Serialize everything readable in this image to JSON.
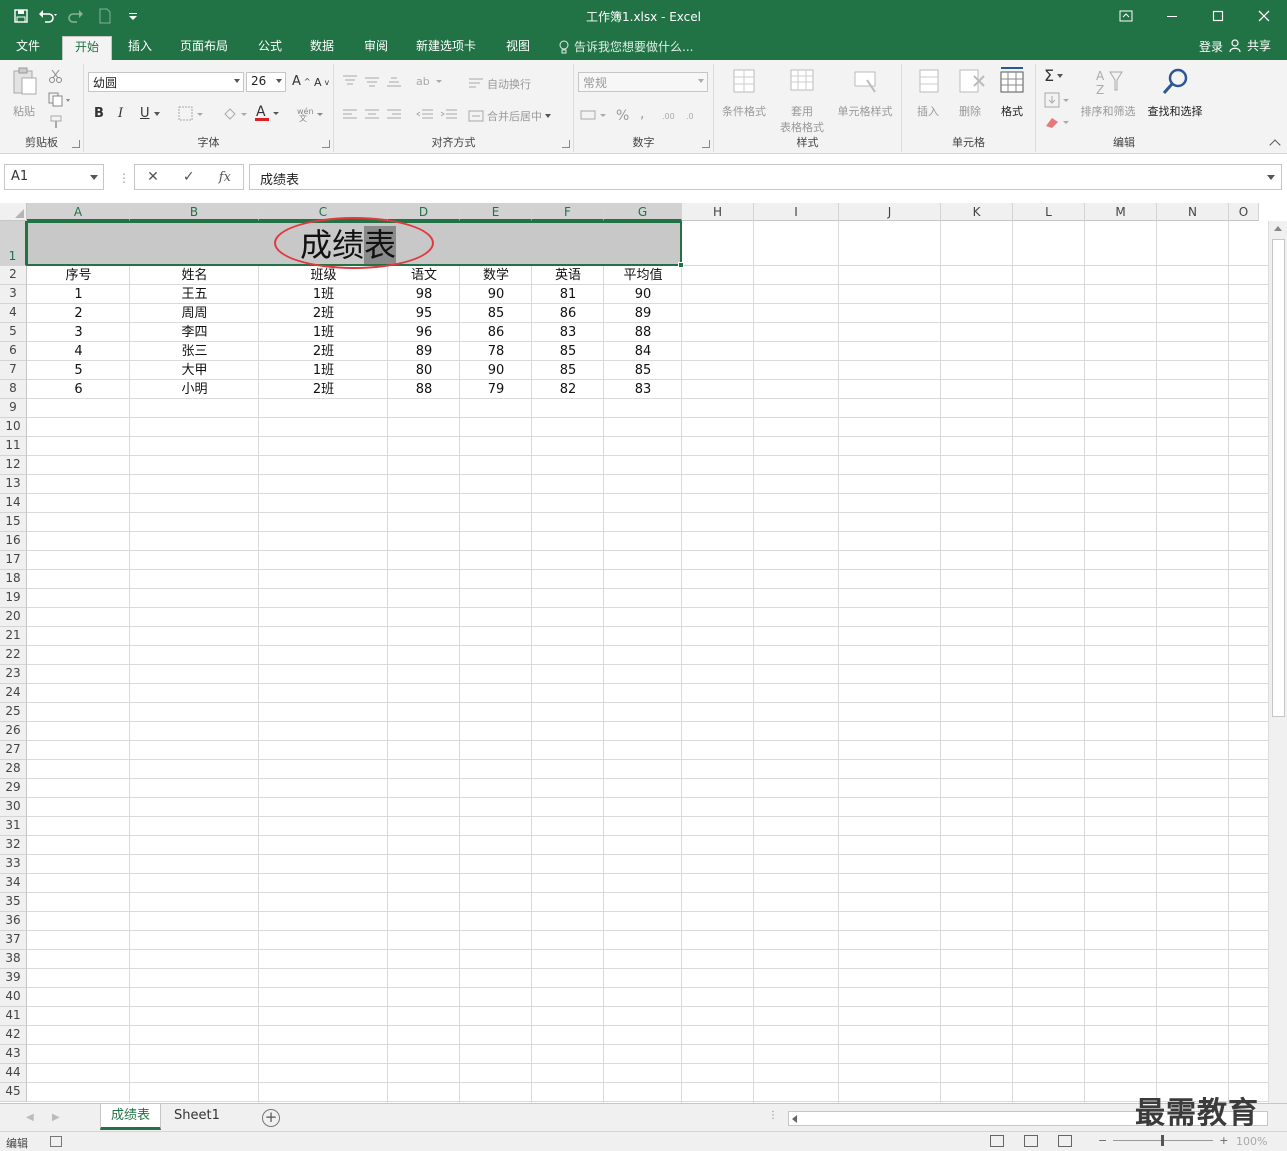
{
  "window": {
    "title": "工作簿1.xlsx - Excel"
  },
  "tabs": [
    {
      "label": "文件"
    },
    {
      "label": "开始"
    },
    {
      "label": "插入"
    },
    {
      "label": "页面布局"
    },
    {
      "label": "公式"
    },
    {
      "label": "数据"
    },
    {
      "label": "审阅"
    },
    {
      "label": "新建选项卡"
    },
    {
      "label": "视图"
    }
  ],
  "tellme": "告诉我您想要做什么...",
  "account": {
    "signin": "登录",
    "share": "共享"
  },
  "ribbon": {
    "clipboard": {
      "paste": "粘贴",
      "label": "剪贴板"
    },
    "font": {
      "name": "幼圆",
      "size": "26",
      "bold": "B",
      "italic": "I",
      "underline": "U",
      "label": "字体"
    },
    "alignment": {
      "wrap": "自动换行",
      "merge": "合并后居中",
      "label": "对齐方式"
    },
    "number": {
      "format": "常规",
      "percent": "%",
      "comma": ",",
      "label": "数字"
    },
    "styles": {
      "conditional": "条件格式",
      "table_l1": "套用",
      "table_l2": "表格格式",
      "cell_styles": "单元格样式",
      "label": "样式"
    },
    "cells": {
      "insert": "插入",
      "delete": "删除",
      "format": "格式",
      "label": "单元格"
    },
    "editing": {
      "sum": "Σ",
      "sort": "排序和筛选",
      "find": "查找和选择",
      "label": "编辑"
    }
  },
  "formula_bar": {
    "name_box": "A1",
    "cancel": "✕",
    "enter": "✓",
    "fx": "fx",
    "content": "成绩表"
  },
  "grid": {
    "columns": [
      "A",
      "B",
      "C",
      "D",
      "E",
      "F",
      "G",
      "H",
      "I",
      "J",
      "K",
      "L",
      "M",
      "N",
      "O"
    ],
    "rows": [
      "1",
      "2",
      "3",
      "4",
      "5",
      "6",
      "7",
      "8",
      "9",
      "10",
      "11",
      "12",
      "13",
      "14",
      "15",
      "16",
      "17",
      "18",
      "19",
      "20",
      "21",
      "22",
      "23",
      "24",
      "25",
      "26",
      "27",
      "28",
      "29",
      "30",
      "31",
      "32",
      "33",
      "34",
      "35",
      "36",
      "37",
      "38",
      "39",
      "40",
      "41",
      "42",
      "43",
      "44",
      "45"
    ],
    "title": "成绩表",
    "headers": [
      "序号",
      "姓名",
      "班级",
      "语文",
      "数学",
      "英语",
      "平均值"
    ],
    "data": [
      [
        "1",
        "王五",
        "1班",
        "98",
        "90",
        "81",
        "90"
      ],
      [
        "2",
        "周周",
        "2班",
        "95",
        "85",
        "86",
        "89"
      ],
      [
        "3",
        "李四",
        "1班",
        "96",
        "86",
        "83",
        "88"
      ],
      [
        "4",
        "张三",
        "2班",
        "89",
        "78",
        "85",
        "84"
      ],
      [
        "5",
        "大甲",
        "1班",
        "80",
        "90",
        "85",
        "85"
      ],
      [
        "6",
        "小明",
        "2班",
        "88",
        "79",
        "82",
        "83"
      ]
    ]
  },
  "sheets": [
    {
      "label": "成绩表"
    },
    {
      "label": "Sheet1"
    }
  ],
  "watermark": "最需教育",
  "status": {
    "mode": "编辑",
    "zoom": "100%"
  },
  "colors": {
    "accent": "#217346",
    "annotation": "#e0393e"
  }
}
